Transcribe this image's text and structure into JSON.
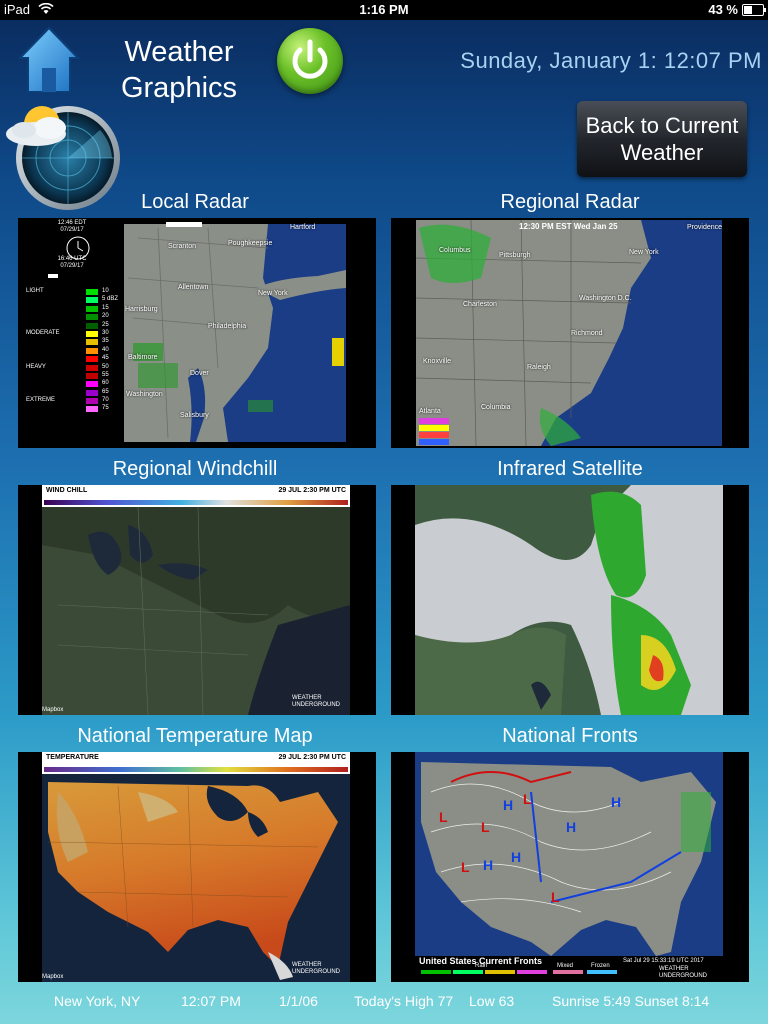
{
  "status_bar": {
    "device": "iPad",
    "time": "1:16 PM",
    "battery": "43 %",
    "battery_level": 0.43
  },
  "header": {
    "title_line1": "Weather",
    "title_line2": "Graphics",
    "datetime": "Sunday, January 1: 12:07 PM",
    "back_button": {
      "line1": "Back to Current",
      "line2": "Weather"
    }
  },
  "panels": {
    "local_radar": {
      "title": "Local Radar",
      "legend_time1": "12:46 EDT",
      "legend_date1": "07/29/17",
      "legend_time2": "16:46 UTC",
      "legend_date2": "07/29/17",
      "legend_scale": [
        {
          "label": "LIGHT",
          "value": "10",
          "color": "#00e000"
        },
        {
          "label": "",
          "value": "5 dBZ",
          "color": "#00ff60"
        },
        {
          "label": "",
          "value": "15",
          "color": "#00c000"
        },
        {
          "label": "",
          "value": "20",
          "color": "#009000"
        },
        {
          "label": "",
          "value": "25",
          "color": "#006000"
        },
        {
          "label": "MODERATE",
          "value": "30",
          "color": "#ffff00"
        },
        {
          "label": "",
          "value": "35",
          "color": "#e6c000"
        },
        {
          "label": "",
          "value": "40",
          "color": "#ff9000"
        },
        {
          "label": "",
          "value": "45",
          "color": "#ff0000"
        },
        {
          "label": "HEAVY",
          "value": "50",
          "color": "#d00000"
        },
        {
          "label": "",
          "value": "55",
          "color": "#c00000"
        },
        {
          "label": "",
          "value": "60",
          "color": "#ff00ff"
        },
        {
          "label": "",
          "value": "65",
          "color": "#9900cc"
        },
        {
          "label": "EXTREME",
          "value": "70",
          "color": "#b000b0"
        },
        {
          "label": "",
          "value": "75",
          "color": "#ff66ff"
        }
      ],
      "cities": [
        "Scranton",
        "Poughkeepsie",
        "Hartford",
        "Allentown",
        "New York",
        "Harrisburg",
        "Philadelphia",
        "Baltimore",
        "Dover",
        "Washington",
        "Salisbury"
      ]
    },
    "regional_radar": {
      "title": "Regional Radar",
      "timestamp": "12:30 PM EST Wed Jan 25",
      "cities": [
        "Providence",
        "Columbus",
        "Pittsburgh",
        "New York",
        "Charleston",
        "Washington D.C.",
        "Richmond",
        "Knoxville",
        "Raleigh",
        "Atlanta",
        "Columbia"
      ]
    },
    "regional_windchill": {
      "title": "Regional Windchill",
      "header_left": "WIND CHILL",
      "header_right": "29 JUL 2:30 PM UTC",
      "attribution": "Mapbox",
      "credit": "WEATHER UNDERGROUND"
    },
    "infrared_satellite": {
      "title": "Infrared Satellite"
    },
    "national_temperature": {
      "title": "National Temperature Map",
      "header_left": "TEMPERATURE",
      "header_right": "29 JUL 2:30 PM UTC",
      "attribution": "Mapbox",
      "credit": "WEATHER UNDERGROUND"
    },
    "national_fronts": {
      "title": "National Fronts",
      "caption": "United States Current Fronts",
      "legend_rain": "Rain",
      "legend_mixed": "Mixed",
      "legend_frozen": "Frozen",
      "timestamp": "Sat Jul 29 15:33:19 UTC 2017",
      "credit": "WEATHER UNDERGROUND"
    }
  },
  "footer": {
    "location": "New York, NY",
    "time": "12:07 PM",
    "date": "1/1/06",
    "high": "Today's High 77",
    "low": "Low 63",
    "sun": "Sunrise 5:49 Sunset 8:14"
  },
  "colors": {
    "accent_text": "#a9d2f2",
    "power_green": "#6cc129",
    "home_blue": "#3aa0e8"
  }
}
